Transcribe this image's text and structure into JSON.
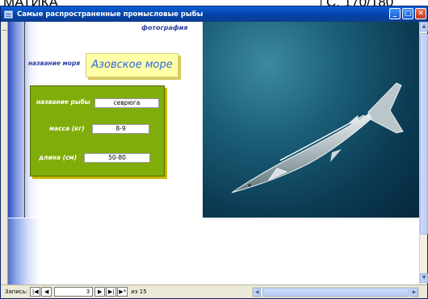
{
  "bleed": {
    "left": "МАТИКА",
    "right": "С. 170/180"
  },
  "window": {
    "title": "Самые распространенные промысловые рыбы",
    "minimize": "_",
    "maximize": "□",
    "close": "✕"
  },
  "form": {
    "photo_label": "фотография",
    "sea_label": "название моря",
    "sea_value": "Азовское море",
    "fish_label": "название рыбы",
    "fish_value": "севрюга",
    "mass_label": "масса (кг)",
    "mass_value": "8-9",
    "length_label": "длина (см)",
    "length_value": "50-80"
  },
  "nav": {
    "label": "Запись:",
    "first": "|◀",
    "prev": "◀",
    "current": "3",
    "next": "▶",
    "last": "▶|",
    "new": "▶*",
    "of_text": "из 15"
  },
  "scroll": {
    "up": "▲",
    "down": "▼",
    "left": "◀",
    "right": "▶"
  },
  "colors": {
    "title_bar": "#0a5fd8",
    "green_panel": "#80ad0a",
    "sea_box": "#ffffa8",
    "label_blue": "#2b3f9e"
  }
}
